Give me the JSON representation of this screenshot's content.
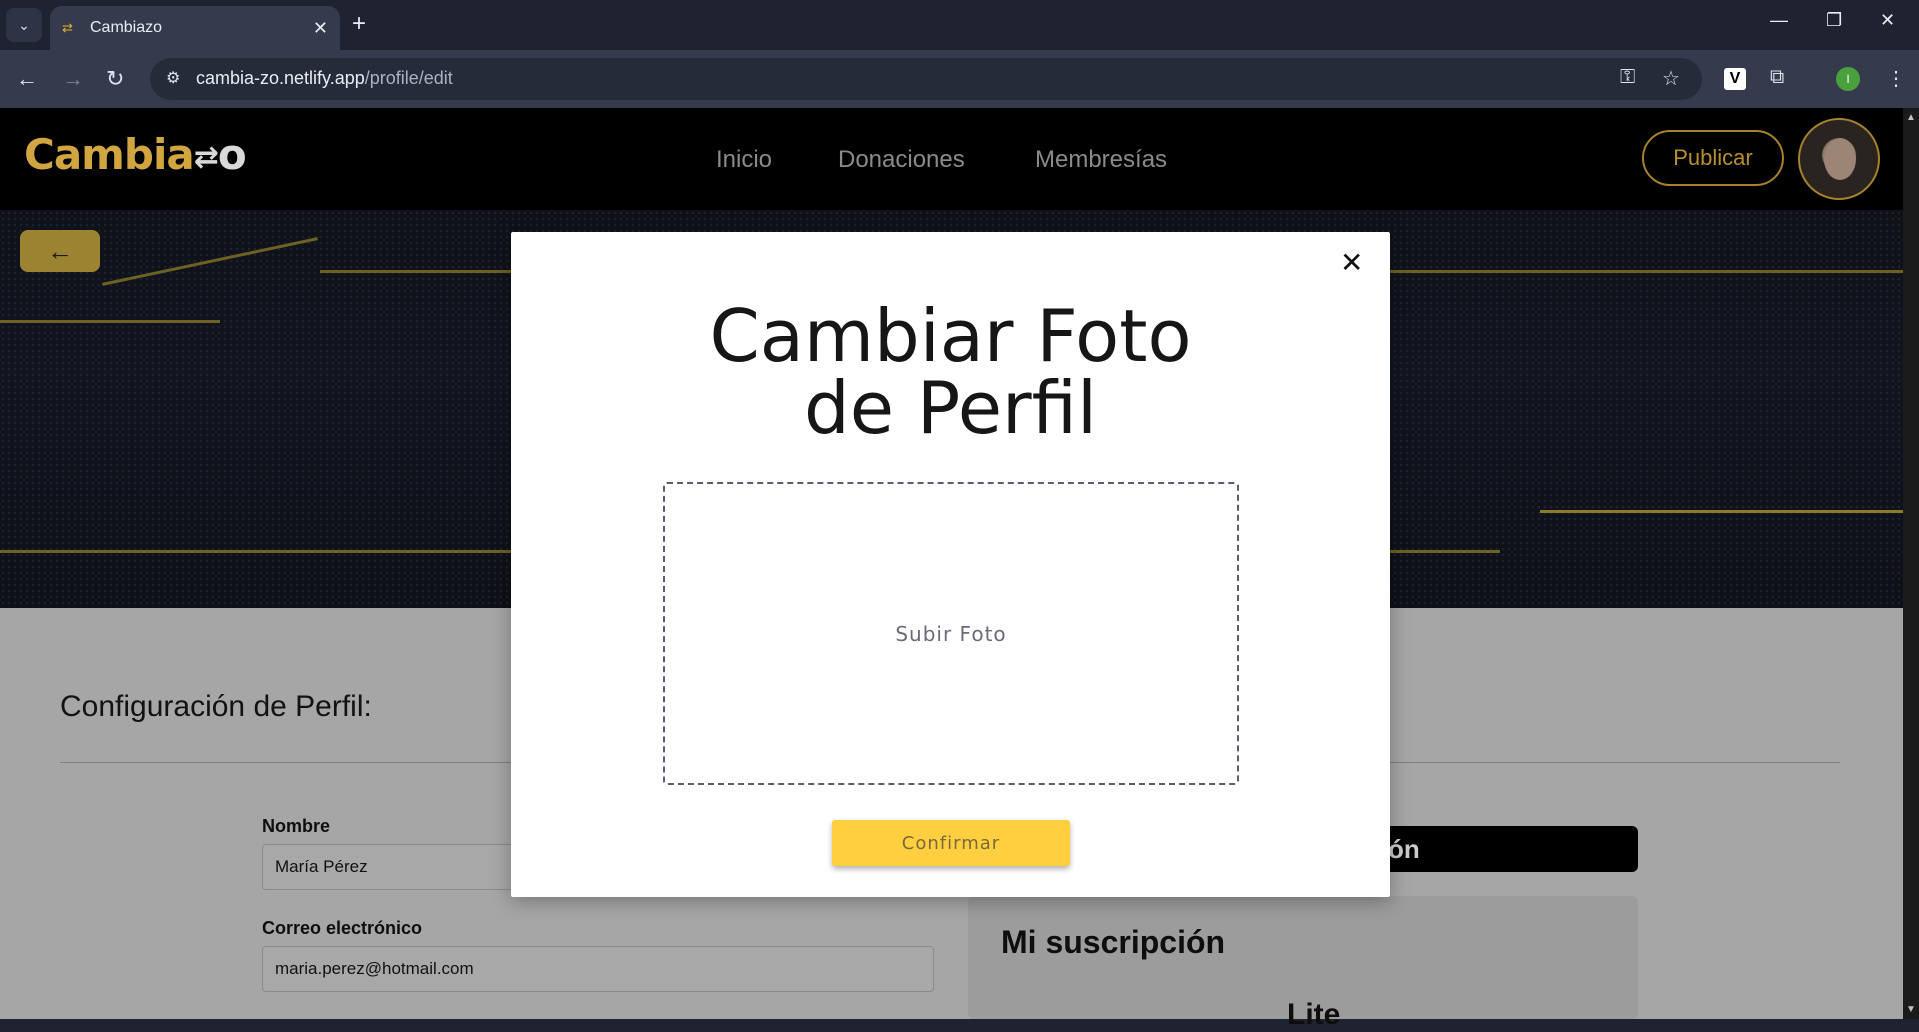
{
  "browser": {
    "tab_title": "Cambiazo",
    "url_host": "cambia-zo.netlify.app",
    "url_path": "/profile/edit",
    "profile_initial": "I",
    "extension_letter": "V"
  },
  "site": {
    "logo_text_main": "Cambia",
    "logo_text_end": "o",
    "nav": [
      "Inicio",
      "Donaciones",
      "Membresías"
    ],
    "publish_label": "Publicar",
    "back_arrow": "←"
  },
  "profile": {
    "section_title": "Configuración de Perfil:",
    "name_label": "Nombre",
    "name_value": "María Pérez",
    "email_label": "Correo electrónico",
    "email_value": "maria.perez@hotmail.com",
    "black_bar_text": "ón",
    "subscription_title": "Mi suscripción",
    "subscription_plan": "Lite"
  },
  "modal": {
    "title_line1": "Cambiar Foto",
    "title_line2": "de Perfil",
    "upload_label": "Subir Foto",
    "confirm_label": "Confirmar",
    "close_glyph": "✕"
  },
  "colors": {
    "brand_gold": "#d1a640",
    "confirm_yellow": "#ffcf40",
    "chrome_dark": "#1f2331"
  }
}
